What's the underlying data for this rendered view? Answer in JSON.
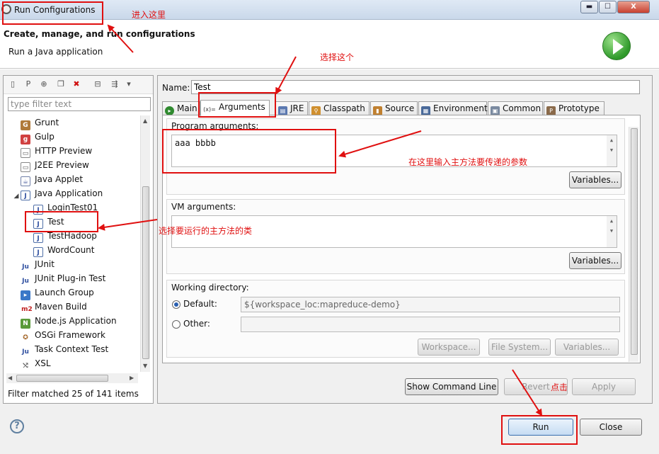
{
  "window": {
    "title": "Run Configurations",
    "min": "▬",
    "max": "☐",
    "close": "X"
  },
  "header": {
    "title": "Create, manage, and run configurations",
    "subtitle": "Run a Java application"
  },
  "filter": {
    "placeholder": "type filter text",
    "status": "Filter matched 25 of 141 items"
  },
  "tree": [
    {
      "label": "Grunt",
      "icon": "grunt-icon"
    },
    {
      "label": "Gulp",
      "icon": "gulp-icon"
    },
    {
      "label": "HTTP Preview",
      "icon": "http-preview-icon"
    },
    {
      "label": "J2EE Preview",
      "icon": "j2ee-preview-icon"
    },
    {
      "label": "Java Applet",
      "icon": "java-applet-icon"
    },
    {
      "label": "Java Application",
      "icon": "java-application-icon"
    },
    {
      "label": "LoginTest01",
      "icon": "java-class-icon"
    },
    {
      "label": "Test",
      "icon": "java-class-icon"
    },
    {
      "label": "TestHadoop",
      "icon": "java-class-icon"
    },
    {
      "label": "WordCount",
      "icon": "java-class-icon"
    },
    {
      "label": "JUnit",
      "icon": "junit-icon"
    },
    {
      "label": "JUnit Plug-in Test",
      "icon": "junit-plugin-icon"
    },
    {
      "label": "Launch Group",
      "icon": "launch-group-icon"
    },
    {
      "label": "Maven Build",
      "icon": "maven-icon"
    },
    {
      "label": "Node.js Application",
      "icon": "nodejs-icon"
    },
    {
      "label": "OSGi Framework",
      "icon": "osgi-icon"
    },
    {
      "label": "Task Context Test",
      "icon": "task-context-icon"
    },
    {
      "label": "XSL",
      "icon": "xsl-icon"
    }
  ],
  "config": {
    "name_label": "Name:",
    "name_value": "Test",
    "tabs": [
      "Main",
      "Arguments",
      "JRE",
      "Classpath",
      "Source",
      "Environment",
      "Common",
      "Prototype"
    ],
    "program_args_label": "Program arguments:",
    "program_args_value": "aaa  bbbb",
    "vm_args_label": "VM arguments:",
    "vm_args_value": "",
    "variables_label": "Variables...",
    "working_dir_label": "Working directory:",
    "default_label": "Default:",
    "default_value": "${workspace_loc:mapreduce-demo}",
    "other_label": "Other:",
    "workspace_btn": "Workspace...",
    "filesystem_btn": "File System...",
    "show_cmd_btn": "Show Command Line",
    "revert_btn": "Revert",
    "apply_btn": "Apply"
  },
  "footer": {
    "run_btn": "Run",
    "close_btn": "Close"
  },
  "annotations": {
    "enter_here": "进入这里",
    "select_this": "选择这个",
    "input_params": "在这里输入主方法要传递的参数",
    "select_class": "选择要运行的主方法的类",
    "click": "点击"
  },
  "colors": {
    "annotation": "#e01010",
    "accent": "#2a5fb0"
  }
}
